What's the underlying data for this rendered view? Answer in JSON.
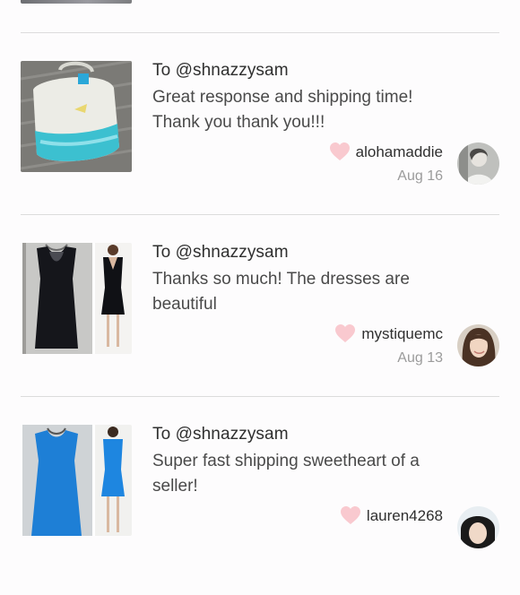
{
  "reviews": [
    {
      "to": "To @shnazzysam",
      "message": "Great response and shipping time! Thank you thank you!!!",
      "author": "alohamaddie",
      "date": "Aug 16",
      "thumb_icon": "tote-bag-photo",
      "avatar_icon": "user-avatar"
    },
    {
      "to": "To @shnazzysam",
      "message": "Thanks so much! The dresses are beautiful",
      "author": "mystiquemc",
      "date": "Aug 13",
      "thumb_icon": "black-dress-photo",
      "avatar_icon": "user-avatar"
    },
    {
      "to": "To @shnazzysam",
      "message": "Super fast shipping sweetheart of a seller!",
      "author": "lauren4268",
      "date": "",
      "thumb_icon": "blue-dress-photo",
      "avatar_icon": "user-avatar"
    }
  ],
  "colors": {
    "heart": "#f9c9cf",
    "divider": "#dcdcdc",
    "blue_dress": "#1e7fd6",
    "black_dress": "#15161b",
    "bag_teal": "#3cc0d0"
  }
}
